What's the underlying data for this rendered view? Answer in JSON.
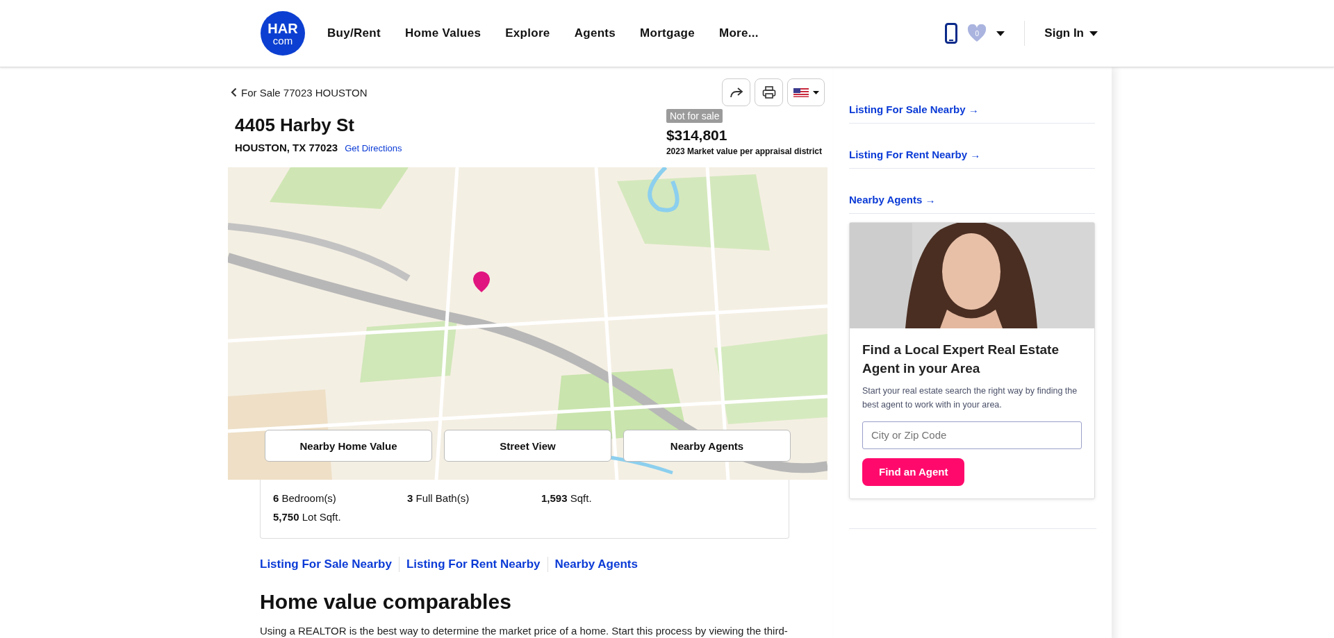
{
  "header": {
    "logo": {
      "top": "HAR",
      "bottom": "com"
    },
    "nav": [
      "Buy/Rent",
      "Home Values",
      "Explore",
      "Agents",
      "Mortgage",
      "More..."
    ],
    "favorites_count": "0",
    "sign_in": "Sign In"
  },
  "listing": {
    "breadcrumb": "For Sale 77023 HOUSTON",
    "title": "4405 Harby St",
    "city": "HOUSTON, TX 77023",
    "directions": "Get Directions",
    "status": "Not for sale",
    "price": "$314,801",
    "price_note": "2023 Market value per appraisal district"
  },
  "map": {
    "kind": "picture",
    "buttons": [
      "Nearby Home Value",
      "Street View",
      "Nearby Agents"
    ]
  },
  "facts": [
    "**6** Bedroom(s)",
    "**3** Full Bath(s)",
    "**1,593** Sqft.",
    "**5,750** Lot Sqft."
  ],
  "links": [
    "Listing For Sale Nearby",
    "Listing For Rent Nearby",
    "Nearby Agents"
  ],
  "section": {
    "heading": "Home value comparables",
    "text": "Using a REALTOR is the best way to determine the market price of a home. Start this process by viewing the third-"
  },
  "sidebar": {
    "links": [
      "Listing For Sale Nearby →",
      "Listing For Rent Nearby →",
      "Nearby Agents →"
    ],
    "card": {
      "kind": "picture",
      "title": "Find a Local Expert Real Estate Agent in your Area",
      "text": "Start your real estate search the right way by finding the best agent to work with in your area.",
      "placeholder": "City or Zip Code",
      "button": "Find an Agent"
    }
  }
}
